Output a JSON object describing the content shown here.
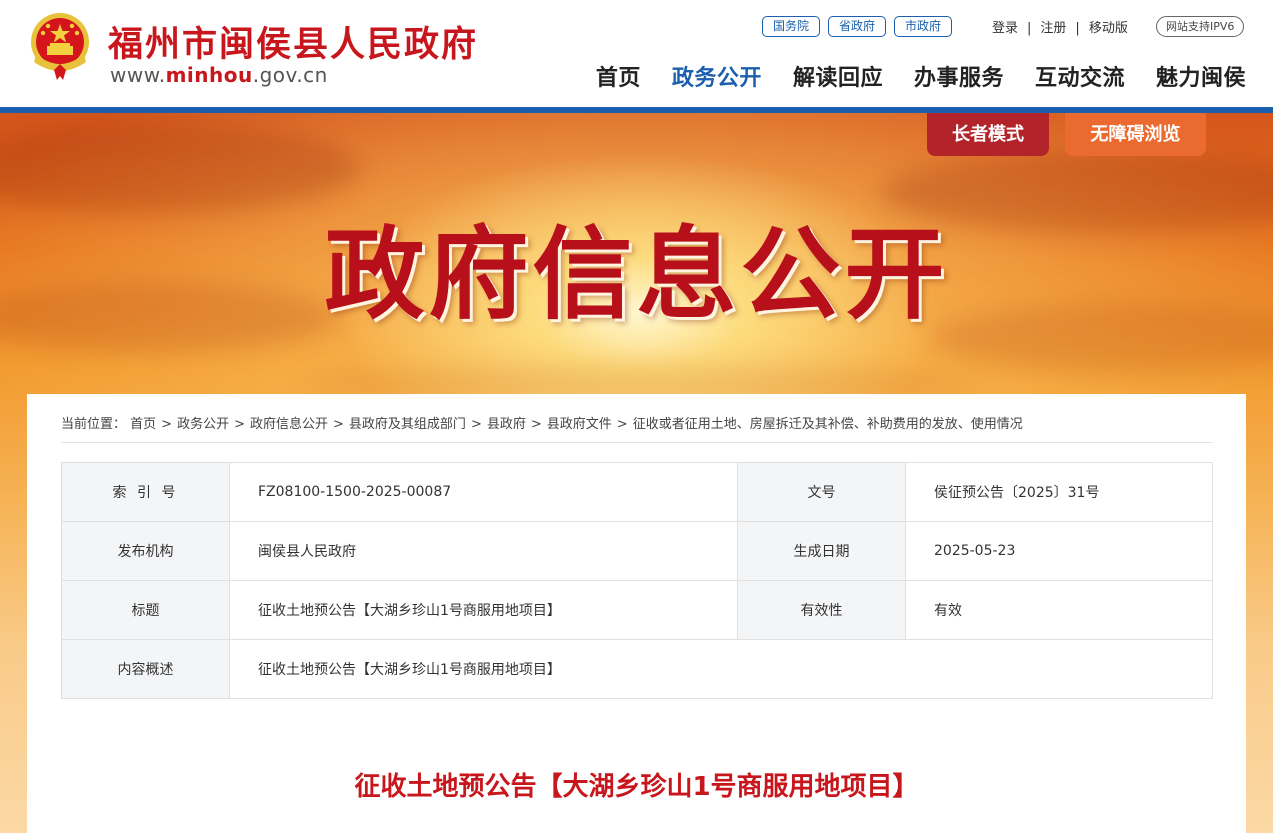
{
  "header": {
    "site_title": "福州市闽侯县人民政府",
    "site_url_prefix": "www.",
    "site_url_domain": "minhou",
    "site_url_suffix": ".gov.cn",
    "top_links": [
      {
        "label": "国务院"
      },
      {
        "label": "省政府"
      },
      {
        "label": "市政府"
      }
    ],
    "login": "登录",
    "register": "注册",
    "mobile": "移动版",
    "sep": "|",
    "ipv6": "网站支持IPV6",
    "nav": [
      {
        "label": "首页"
      },
      {
        "label": "政务公开",
        "active": true
      },
      {
        "label": "解读回应"
      },
      {
        "label": "办事服务"
      },
      {
        "label": "互动交流"
      },
      {
        "label": "魅力闽侯"
      }
    ]
  },
  "banner": {
    "title": "政府信息公开",
    "elder_mode": "长者模式",
    "accessible": "无障碍浏览"
  },
  "breadcrumb": {
    "prefix": "当前位置：",
    "sep": ">",
    "items": [
      "首页",
      "政务公开",
      "政府信息公开",
      "县政府及其组成部门",
      "县政府",
      "县政府文件",
      "征收或者征用土地、房屋拆迁及其补偿、补助费用的发放、使用情况"
    ]
  },
  "info": {
    "index_label": "索 引 号",
    "index_value": "FZ08100-1500-2025-00087",
    "docno_label": "文号",
    "docno_value": "侯征预公告〔2025〕31号",
    "publisher_label": "发布机构",
    "publisher_value": "闽侯县人民政府",
    "date_label": "生成日期",
    "date_value": "2025-05-23",
    "title_label": "标题",
    "title_value": "征收土地预公告【大湖乡珍山1号商服用地项目】",
    "validity_label": "有效性",
    "validity_value": "有效",
    "summary_label": "内容概述",
    "summary_value": "征收土地预公告【大湖乡珍山1号商服用地项目】"
  },
  "document": {
    "title": "征收土地预公告【大湖乡珍山1号商服用地项目】"
  },
  "colors": {
    "brand_red": "#c8161d",
    "brand_blue": "#1b5fae"
  }
}
